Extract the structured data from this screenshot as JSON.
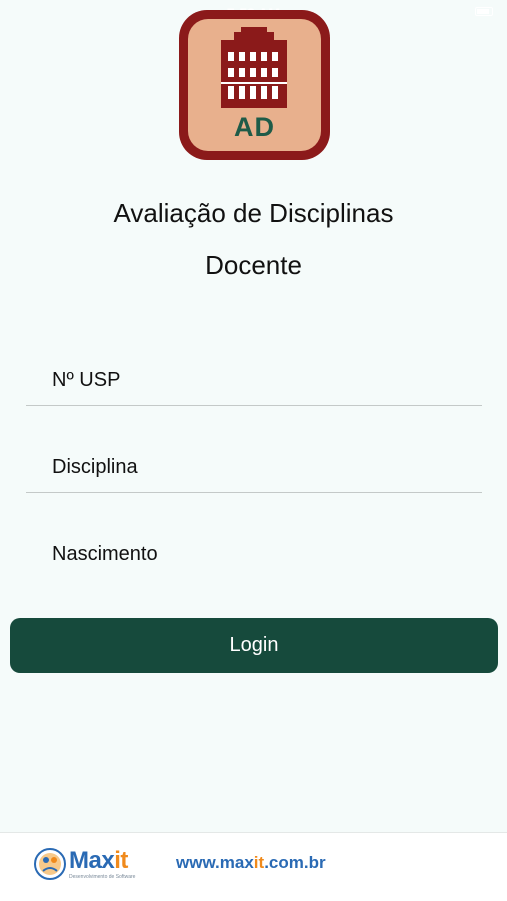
{
  "status_bar": {
    "time": "7:58 AM"
  },
  "app_icon": {
    "label": "AD"
  },
  "header": {
    "title": "Avaliação de Disciplinas",
    "subtitle": "Docente"
  },
  "form": {
    "usp_placeholder": "Nº USP",
    "usp_value": "",
    "disciplina_placeholder": "Disciplina",
    "disciplina_value": "",
    "nascimento_placeholder": "Nascimento",
    "nascimento_value": "",
    "login_label": "Login"
  },
  "footer": {
    "brand_prefix": "Max",
    "brand_suffix": "it",
    "brand_tagline": "Desenvolvimento de Software",
    "url_prefix": "www.max",
    "url_mid": "it",
    "url_suffix": ".com.br"
  },
  "colors": {
    "background": "#f5fbfa",
    "primary": "#164a3c",
    "icon_frame": "#8b1a1a",
    "icon_fill": "#e8b08d",
    "brand_blue": "#2a6ab4",
    "brand_orange": "#f08a1c"
  }
}
